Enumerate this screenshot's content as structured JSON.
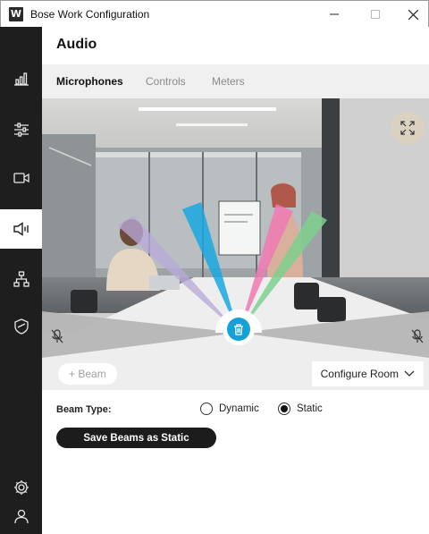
{
  "window": {
    "title": "Bose Work Configuration",
    "logo_letter": "W"
  },
  "sidebar": {
    "items": [
      {
        "icon": "bar-chart-icon",
        "active": false
      },
      {
        "icon": "sliders-icon",
        "active": false
      },
      {
        "icon": "camera-icon",
        "active": false
      },
      {
        "icon": "speaker-icon",
        "active": true
      },
      {
        "icon": "network-icon",
        "active": false
      },
      {
        "icon": "shield-icon",
        "active": false
      },
      {
        "icon": "gear-icon",
        "active": false
      },
      {
        "icon": "user-icon",
        "active": false
      }
    ]
  },
  "page": {
    "title": "Audio"
  },
  "tabs": [
    {
      "label": "Microphones",
      "active": true
    },
    {
      "label": "Controls",
      "active": false
    },
    {
      "label": "Meters",
      "active": false
    }
  ],
  "beams": {
    "colors": [
      "#b8a9d9",
      "#19a8e0",
      "#f07ab4",
      "#7fd08e"
    ]
  },
  "controls": {
    "add_beam_label": "+ Beam",
    "configure_room_label": "Configure Room",
    "beam_type_label": "Beam Type:",
    "beam_type_options": [
      {
        "label": "Dynamic",
        "selected": false
      },
      {
        "label": "Static",
        "selected": true
      }
    ],
    "save_button_label": "Save Beams as Static"
  }
}
